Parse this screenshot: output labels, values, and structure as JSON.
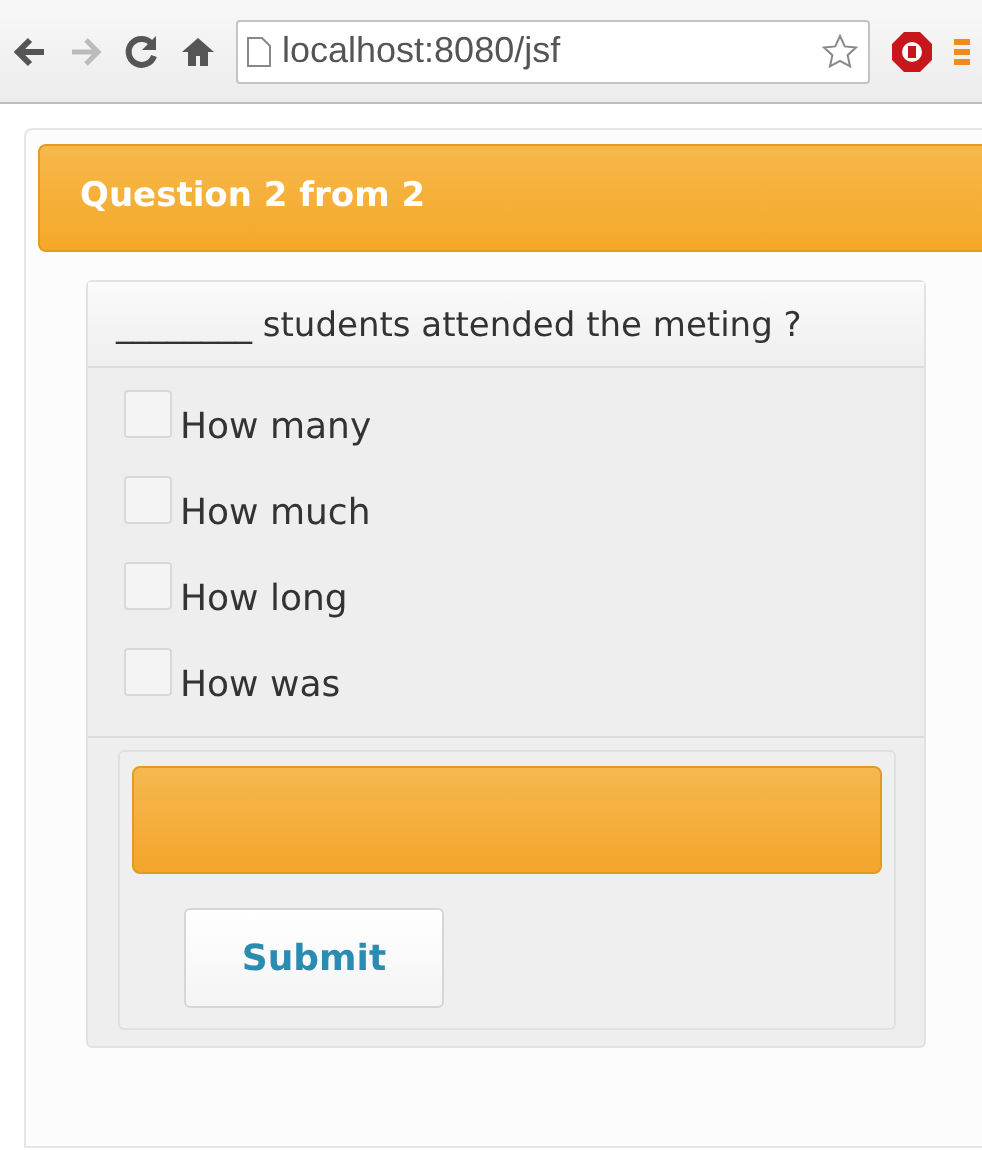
{
  "browser": {
    "url": "localhost:8080/jsf"
  },
  "panel": {
    "title": "Question 2 from 2"
  },
  "question": {
    "text": "________ students attended the meting ?"
  },
  "options": [
    {
      "label": "How many",
      "checked": false
    },
    {
      "label": "How much",
      "checked": false
    },
    {
      "label": "How long",
      "checked": false
    },
    {
      "label": "How was",
      "checked": false
    }
  ],
  "footer": {
    "button": "Submit"
  }
}
